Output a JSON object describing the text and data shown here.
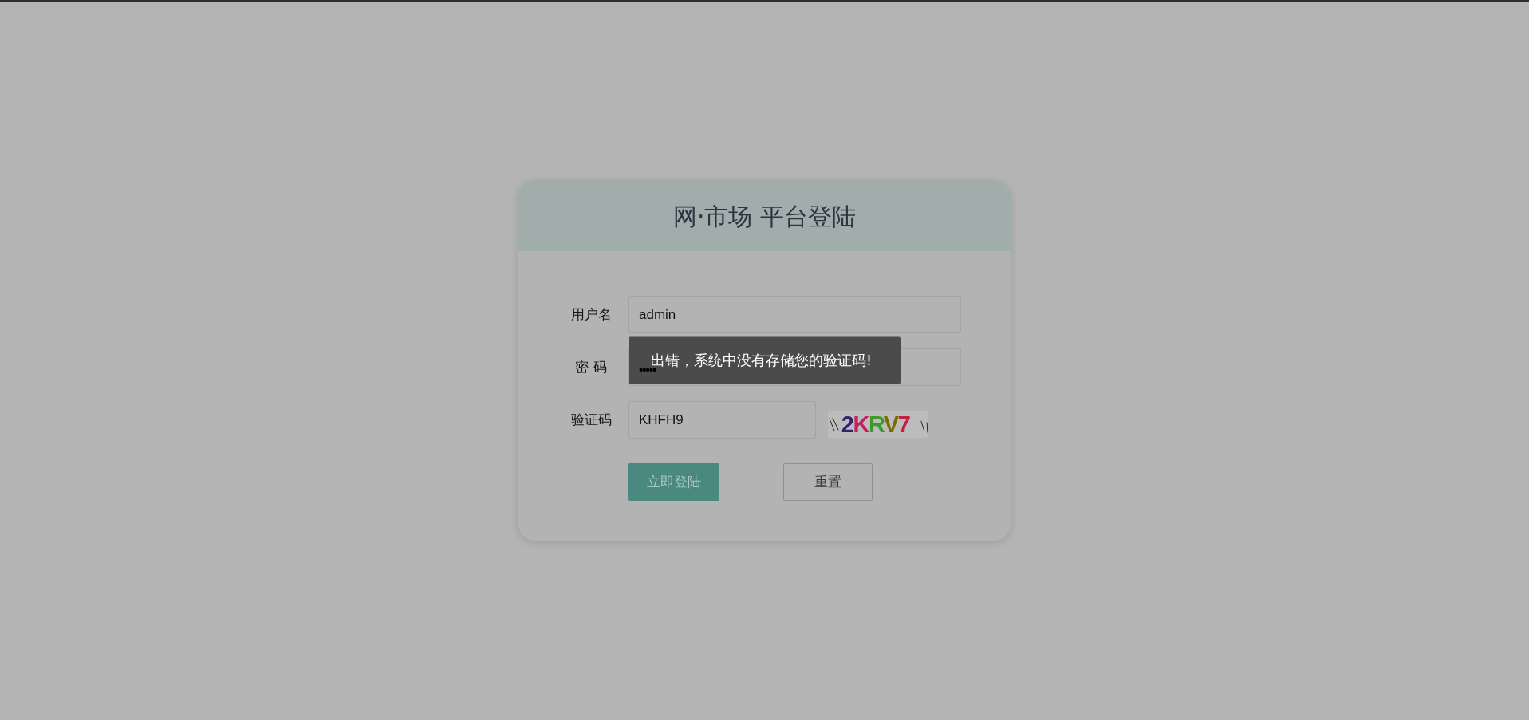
{
  "title": "网·市场 平台登陆",
  "form": {
    "fields": [
      {
        "kind": "text",
        "label": "用户名",
        "value": "admin"
      },
      {
        "kind": "password",
        "label": "密 码",
        "value": "•••••"
      },
      {
        "kind": "captcha",
        "label": "验证码",
        "value": "KHFH9",
        "captcha": "2KRV7"
      }
    ]
  },
  "buttons": [
    {
      "kind": "primary",
      "label": "立即登陆"
    },
    {
      "kind": "secondary",
      "label": "重置"
    }
  ],
  "toast": {
    "message": "出错，系统中没有存储您的验证码!"
  }
}
